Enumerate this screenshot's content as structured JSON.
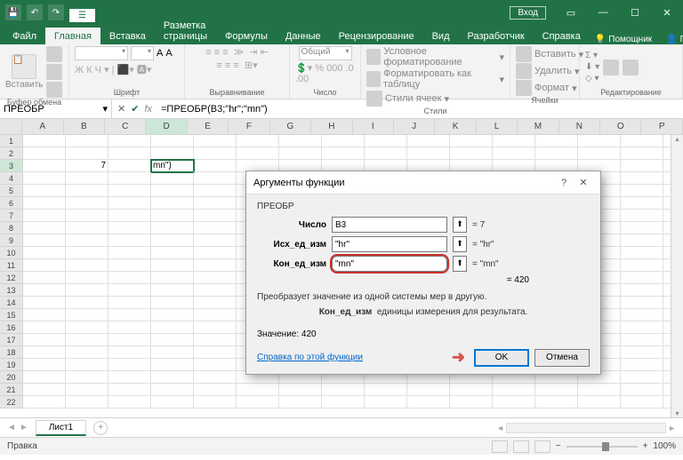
{
  "title_bar": {
    "login": "Вход",
    "qat_tab": "☰"
  },
  "tabs": {
    "file": "Файл",
    "home": "Главная",
    "insert": "Вставка",
    "layout": "Разметка страницы",
    "formulas": "Формулы",
    "data": "Данные",
    "review": "Рецензирование",
    "view": "Вид",
    "developer": "Разработчик",
    "help": "Справка",
    "helper": "Помощник",
    "share": "Поделиться"
  },
  "ribbon": {
    "paste": "Вставить",
    "clipboard": "Буфер обмена",
    "font": "Шрифт",
    "alignment": "Выравнивание",
    "number": "Число",
    "styles": "Стили",
    "cells": "Ячейки",
    "editing": "Редактирование",
    "cond_format": "Условное форматирование",
    "as_table": "Форматировать как таблицу",
    "cell_styles": "Стили ячеек",
    "insert_c": "Вставить",
    "delete_c": "Удалить",
    "format_c": "Формат",
    "number_format": "Общий"
  },
  "formula_bar": {
    "name": "ПРЕОБР",
    "formula": "=ПРЕОБР(B3;\"hr\";\"mn\")"
  },
  "columns": [
    "A",
    "B",
    "C",
    "D",
    "E",
    "F",
    "G",
    "H",
    "I",
    "J",
    "K",
    "L",
    "M",
    "N",
    "O",
    "P"
  ],
  "grid": {
    "b3": "7",
    "d3": "mn\")"
  },
  "sheet": {
    "name": "Лист1",
    "status": "Правка",
    "zoom": "100%"
  },
  "dialog": {
    "title": "Аргументы функции",
    "func": "ПРЕОБР",
    "args": [
      {
        "label": "Число",
        "value": "B3",
        "result": "= 7",
        "hl": false
      },
      {
        "label": "Исх_ед_изм",
        "value": "\"hr\"",
        "result": "= \"hr\"",
        "hl": false
      },
      {
        "label": "Кон_ед_изм",
        "value": "\"mn\"",
        "result": "= \"mn\"",
        "hl": true
      }
    ],
    "computed": "= 420",
    "desc": "Преобразует значение из одной системы мер в другую.",
    "arg_desc_label": "Кон_ед_изм",
    "arg_desc": "единицы измерения для результата.",
    "value_label": "Значение:",
    "value": "420",
    "help_link": "Справка по этой функции",
    "ok": "OK",
    "cancel": "Отмена"
  }
}
